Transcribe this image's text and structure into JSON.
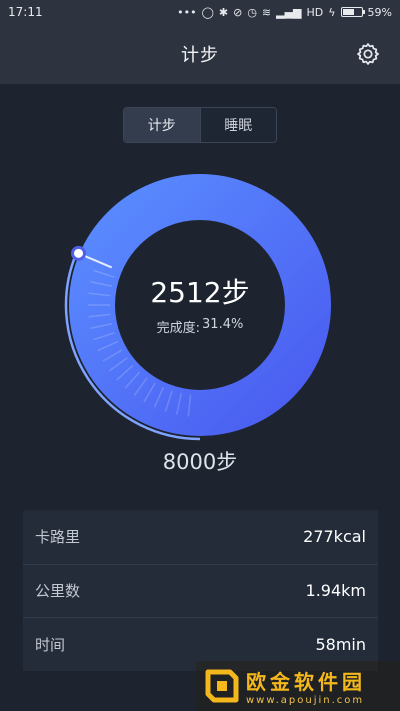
{
  "status_bar": {
    "time": "17:11",
    "network": "HD",
    "battery": "59%",
    "battery_level": 0.59
  },
  "header": {
    "title": "计步",
    "settings_icon": "gear-icon"
  },
  "tabs": [
    {
      "label": "计步",
      "active": true
    },
    {
      "label": "睡眠",
      "active": false
    }
  ],
  "ring": {
    "steps": "2512步",
    "progress_label": "完成度:",
    "progress_value": "31.4%",
    "progress_fraction": 0.314,
    "colors": {
      "start": "#5a8cff",
      "end": "#4a5cf0",
      "track": "#2b3a66"
    }
  },
  "goal": "8000步",
  "stats": [
    {
      "label": "卡路里",
      "value": "277kcal"
    },
    {
      "label": "公里数",
      "value": "1.94km"
    },
    {
      "label": "时间",
      "value": "58min"
    }
  ],
  "watermark": {
    "title": "欧金软件园",
    "url": "www.apoujin.com"
  }
}
